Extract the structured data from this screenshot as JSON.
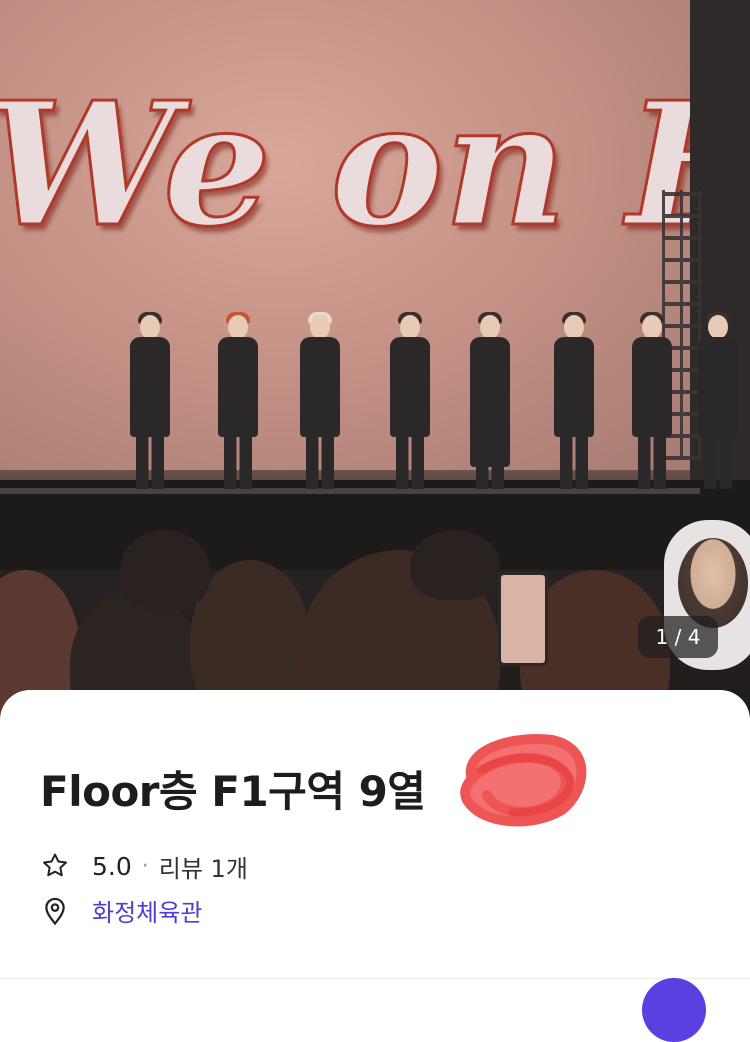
{
  "photo": {
    "sign_text": "We on Fire",
    "counter": "1 / 4"
  },
  "listing": {
    "title": "Floor층 F1구역 9열",
    "rating": "5.0",
    "separator": "·",
    "reviews": "리뷰 1개",
    "venue": "화정체육관"
  },
  "colors": {
    "venue_link": "#4c3fd1",
    "accent": "#5b3fe0",
    "redaction": "#f05a5a"
  },
  "icons": {
    "rating": "star-icon",
    "location": "pin-icon"
  }
}
